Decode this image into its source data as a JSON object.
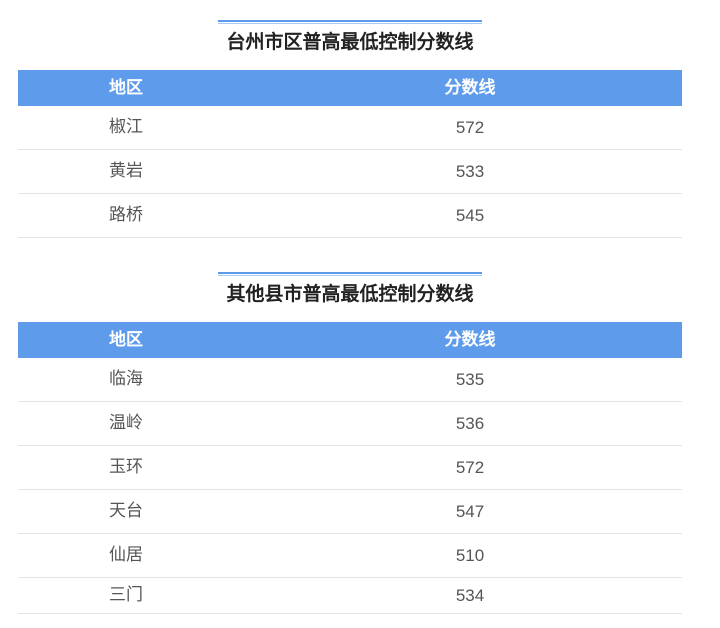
{
  "sections": [
    {
      "title": "台州市区普高最低控制分数线",
      "header": {
        "region": "地区",
        "score": "分数线"
      },
      "rows": [
        {
          "region": "椒江",
          "score": "572"
        },
        {
          "region": "黄岩",
          "score": "533"
        },
        {
          "region": "路桥",
          "score": "545"
        }
      ]
    },
    {
      "title": "其他县市普高最低控制分数线",
      "header": {
        "region": "地区",
        "score": "分数线"
      },
      "rows": [
        {
          "region": "临海",
          "score": "535"
        },
        {
          "region": "温岭",
          "score": "536"
        },
        {
          "region": "玉环",
          "score": "572"
        },
        {
          "region": "天台",
          "score": "547"
        },
        {
          "region": "仙居",
          "score": "510"
        },
        {
          "region": "三门",
          "score": "534"
        }
      ]
    }
  ],
  "colors": {
    "header_bg": "#5e9ceb",
    "title_rule": "#5b9bea",
    "row_divider": "#e4e4e4"
  }
}
